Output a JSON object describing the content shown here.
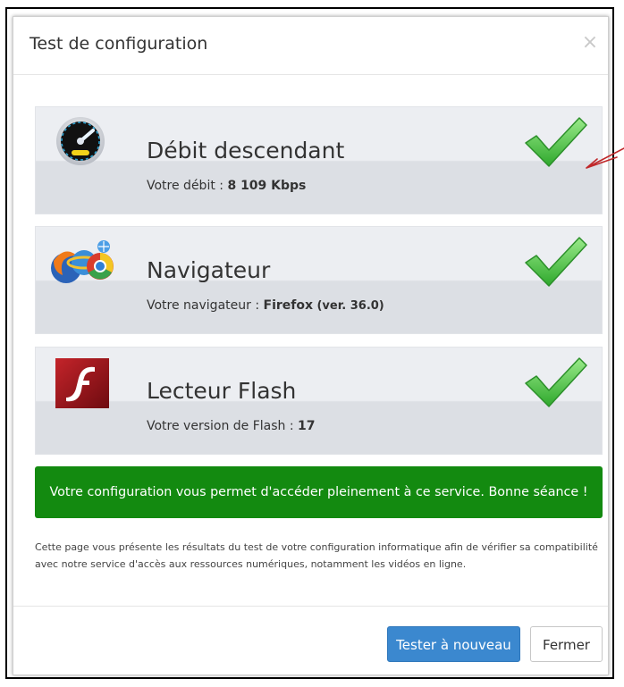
{
  "dialog": {
    "title": "Test de configuration",
    "close_symbol": "×"
  },
  "checks": [
    {
      "title": "Débit descendant",
      "detail_label": "Votre débit : ",
      "detail_value": "8 109 Kbps",
      "icon": "speedometer-icon",
      "status": "ok"
    },
    {
      "title": "Navigateur",
      "detail_label": "Votre navigateur : ",
      "detail_value": "Firefox",
      "detail_extra": "(ver. 36.0)",
      "icon": "browsers-icon",
      "status": "ok"
    },
    {
      "title": "Lecteur Flash",
      "detail_label": "Votre version de Flash : ",
      "detail_value": "17",
      "icon": "flash-player-icon",
      "status": "ok"
    }
  ],
  "success_message": "Votre configuration vous permet d'accéder pleinement à ce service. Bonne séance !",
  "info_text": "Cette page vous présente les résultats du test de votre configuration informatique afin de vérifier sa compatibilité avec notre service d'accès aux ressources numériques, notamment les vidéos en ligne.",
  "footer": {
    "retry_label": "Tester à nouveau",
    "close_label": "Fermer"
  },
  "colors": {
    "success_bg": "#138a10",
    "primary_button": "#3b88cf",
    "check_green": "#4cc24a",
    "annotation_red": "#c0282a"
  }
}
